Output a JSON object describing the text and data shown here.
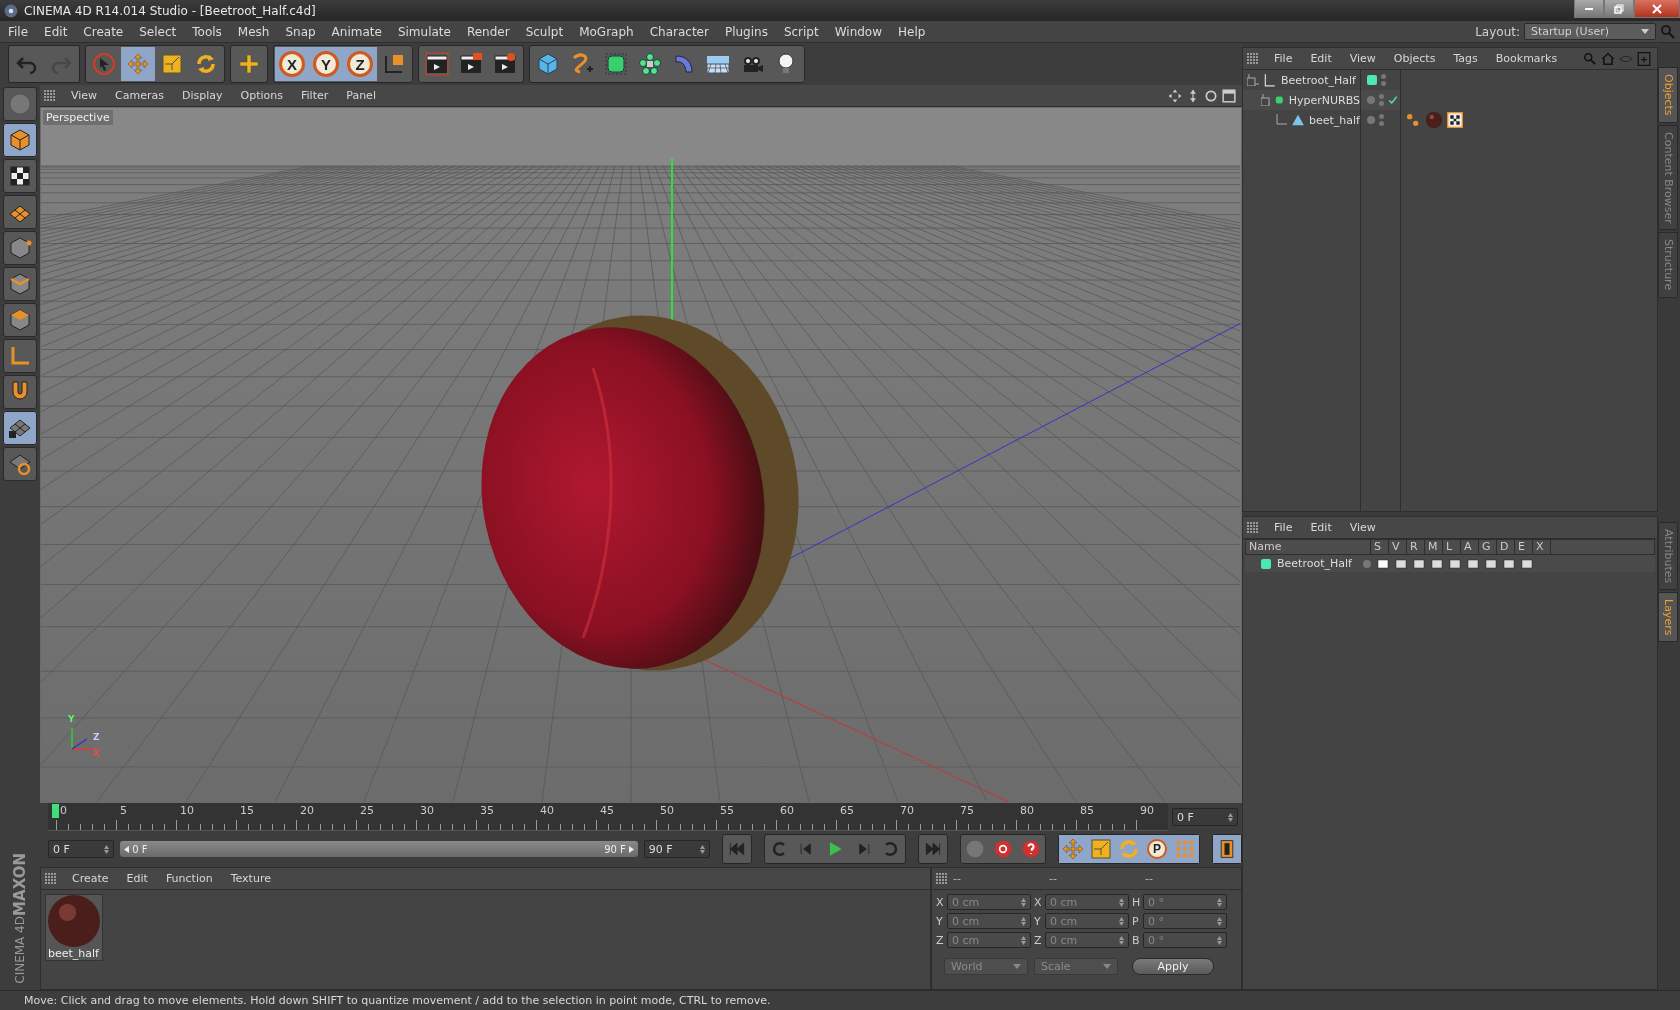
{
  "window": {
    "title": "CINEMA 4D R14.014 Studio - [Beetroot_Half.c4d]"
  },
  "menu": [
    "File",
    "Edit",
    "Create",
    "Select",
    "Tools",
    "Mesh",
    "Snap",
    "Animate",
    "Simulate",
    "Render",
    "Sculpt",
    "MoGraph",
    "Character",
    "Plugins",
    "Script",
    "Window",
    "Help"
  ],
  "layout": {
    "label": "Layout:",
    "value": "Startup (User)"
  },
  "toolbar": [
    [
      {
        "kind": "undo",
        "selected": false,
        "disabled": false
      },
      {
        "kind": "redo",
        "selected": false,
        "disabled": true
      }
    ],
    [
      {
        "kind": "select",
        "selected": false,
        "disabled": false
      },
      {
        "kind": "move",
        "selected": true,
        "disabled": false
      },
      {
        "kind": "scale",
        "selected": false,
        "disabled": false
      },
      {
        "kind": "rotate",
        "selected": false,
        "disabled": false
      }
    ],
    [
      {
        "kind": "cross",
        "selected": false,
        "disabled": false
      }
    ],
    [
      {
        "kind": "axis",
        "label": "X",
        "selected": true,
        "disabled": false
      },
      {
        "kind": "axis",
        "label": "Y",
        "selected": true,
        "disabled": false
      },
      {
        "kind": "axis",
        "label": "Z",
        "selected": true,
        "disabled": false
      },
      {
        "kind": "coords",
        "selected": false,
        "disabled": false
      }
    ],
    [
      {
        "kind": "render-view",
        "selected": false,
        "disabled": false
      },
      {
        "kind": "render-pv",
        "selected": false,
        "disabled": false
      },
      {
        "kind": "render-settings",
        "selected": false,
        "disabled": false
      }
    ],
    [
      {
        "kind": "cube",
        "selected": false,
        "disabled": false
      },
      {
        "kind": "spline",
        "selected": false,
        "disabled": false
      },
      {
        "kind": "nurbs",
        "selected": false,
        "disabled": false
      },
      {
        "kind": "array",
        "selected": false,
        "disabled": false
      },
      {
        "kind": "deformer",
        "selected": false,
        "disabled": false
      },
      {
        "kind": "floor",
        "selected": false,
        "disabled": false
      },
      {
        "kind": "camera",
        "selected": false,
        "disabled": false
      },
      {
        "kind": "light",
        "selected": false,
        "disabled": false
      }
    ]
  ],
  "palette": [
    {
      "kind": "view",
      "selected": false
    },
    {
      "kind": "model",
      "selected": true
    },
    {
      "kind": "texture",
      "selected": false
    },
    {
      "kind": "workplane",
      "selected": false
    },
    {
      "kind": "points",
      "selected": false
    },
    {
      "kind": "edges",
      "selected": false
    },
    {
      "kind": "polygons",
      "selected": false
    },
    {
      "kind": "axis",
      "selected": false
    },
    {
      "kind": "magnet",
      "selected": false
    },
    {
      "kind": "lock-grid",
      "selected": true
    },
    {
      "kind": "grid-rotate",
      "selected": false
    }
  ],
  "logo": {
    "brand": "MAXON",
    "product": "CINEMA 4D"
  },
  "viewport": {
    "menu": [
      "View",
      "Cameras",
      "Display",
      "Options",
      "Filter",
      "Panel"
    ],
    "camera_label": "Perspective",
    "axis_gizmo": [
      "Y",
      "Z",
      "X"
    ]
  },
  "timeline": {
    "ticks": [
      "0",
      "5",
      "10",
      "15",
      "20",
      "25",
      "30",
      "35",
      "40",
      "45",
      "50",
      "55",
      "60",
      "65",
      "70",
      "75",
      "80",
      "85",
      "90"
    ],
    "playhead": {
      "level": 0
    },
    "current_frame": "0 F",
    "start": "0 F",
    "range": {
      "start": "0 F",
      "end": "90 F",
      "level": 1
    },
    "end": "90 F",
    "playback": [
      {
        "kind": "first"
      },
      {
        "kind": "prev-key"
      },
      {
        "kind": "prev-frame"
      },
      {
        "kind": "play"
      },
      {
        "kind": "next-frame"
      },
      {
        "kind": "next-key"
      },
      {
        "kind": "last"
      }
    ],
    "record": [
      {
        "kind": "motion",
        "selected": false
      },
      {
        "kind": "record",
        "selected": false
      },
      {
        "kind": "auto",
        "selected": false
      }
    ],
    "keys": [
      {
        "kind": "move",
        "selected": true
      },
      {
        "kind": "scale",
        "selected": true
      },
      {
        "kind": "rotate",
        "selected": true
      },
      {
        "kind": "param",
        "label": "P",
        "selected": true
      },
      {
        "kind": "points",
        "selected": true
      }
    ],
    "scheme": {
      "selected": true
    }
  },
  "materials": {
    "menu": [
      "Create",
      "Edit",
      "Function",
      "Texture"
    ],
    "items": [
      {
        "name": "beet_half"
      }
    ]
  },
  "coordinates": {
    "headers": [
      "--",
      "--",
      "--"
    ],
    "columns": [
      [
        {
          "label": "X",
          "value": "0 cm"
        },
        {
          "label": "Y",
          "value": "0 cm"
        },
        {
          "label": "Z",
          "value": "0 cm"
        }
      ],
      [
        {
          "label": "X",
          "value": "0 cm"
        },
        {
          "label": "Y",
          "value": "0 cm"
        },
        {
          "label": "Z",
          "value": "0 cm"
        }
      ],
      [
        {
          "label": "H",
          "value": "0 °"
        },
        {
          "label": "P",
          "value": "0 °"
        },
        {
          "label": "B",
          "value": "0 °"
        }
      ]
    ],
    "dropdowns": [
      "World",
      "Scale"
    ],
    "apply": "Apply"
  },
  "objects": {
    "menu": [
      "File",
      "Edit",
      "View",
      "Objects",
      "Tags",
      "Bookmarks"
    ],
    "tree": [
      {
        "name": "Beetroot_Half",
        "kind": "null",
        "color": "#4de8b8",
        "checked": false,
        "children": [
          {
            "name": "HyperNURBS",
            "kind": "nurbs",
            "checked": true,
            "children": [
              {
                "name": "beet_half",
                "kind": "polygon",
                "checked": false,
                "tags": [
                  {
                    "kind": "phong"
                  },
                  {
                    "kind": "material"
                  },
                  {
                    "kind": "texture"
                  }
                ]
              }
            ]
          }
        ]
      }
    ]
  },
  "layers": {
    "menu": [
      "File",
      "Edit",
      "View"
    ],
    "columns": [
      "Name",
      "S",
      "V",
      "R",
      "M",
      "L",
      "A",
      "G",
      "D",
      "E",
      "X"
    ],
    "rows": [
      {
        "name": "Beetroot_Half",
        "color": "#4de8b8"
      }
    ]
  },
  "side_tabs_top": [
    {
      "label": "Objects",
      "selected": true
    },
    {
      "label": "Content Browser",
      "selected": false
    },
    {
      "label": "Structure",
      "selected": false
    }
  ],
  "side_tabs_bottom": [
    {
      "label": "Attributes",
      "selected": false
    },
    {
      "label": "Layers",
      "selected": true
    }
  ],
  "status": "Move: Click and drag to move elements. Hold down SHIFT to quantize movement / add to the selection in point mode, CTRL to remove."
}
